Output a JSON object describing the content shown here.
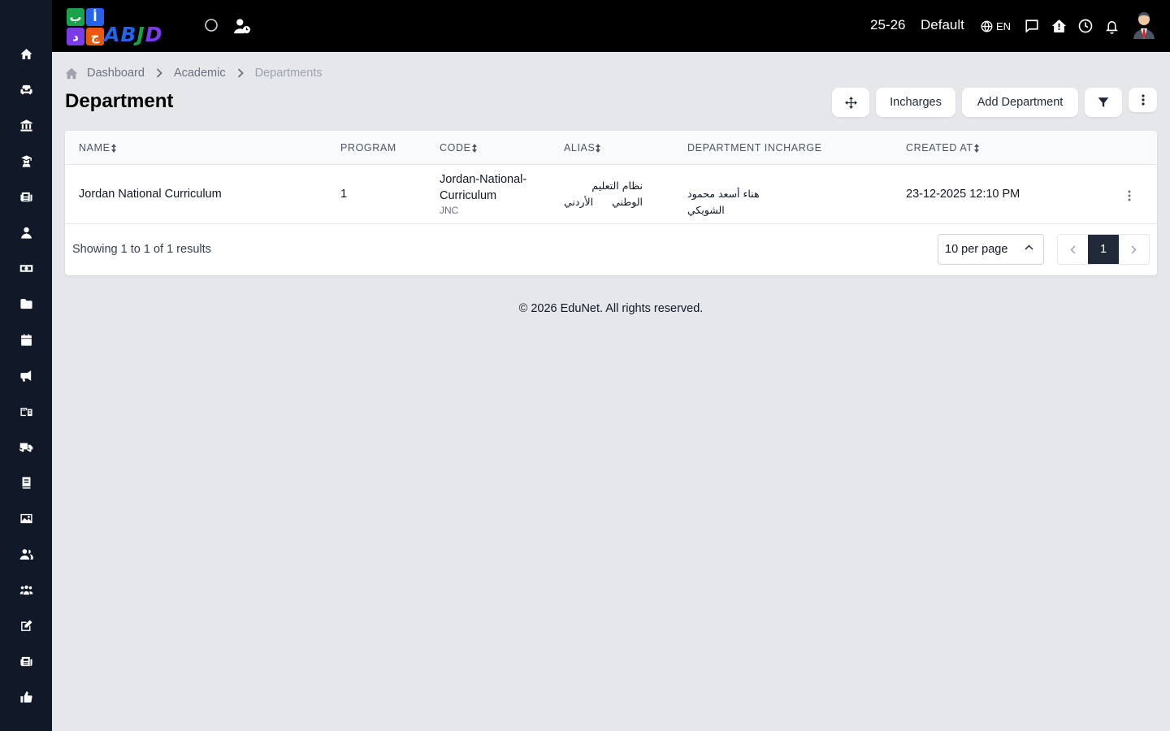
{
  "logo": {
    "tiles": [
      "ب",
      "أ",
      "د",
      "ج"
    ],
    "word": "ABJD",
    "colors": [
      "#16a34a",
      "#2563eb",
      "#7c3aed",
      "#ea580c"
    ]
  },
  "sidebar": {
    "items": [
      {
        "icon": "home-icon"
      },
      {
        "icon": "sofa-icon"
      },
      {
        "icon": "bank-icon"
      },
      {
        "icon": "graduate-icon"
      },
      {
        "icon": "newspaper-icon"
      },
      {
        "icon": "user-tie-icon"
      },
      {
        "icon": "money-icon"
      },
      {
        "icon": "folder-icon"
      },
      {
        "icon": "calendar-icon"
      },
      {
        "icon": "megaphone-icon"
      },
      {
        "icon": "school-icon"
      },
      {
        "icon": "truck-icon"
      },
      {
        "icon": "book-icon"
      },
      {
        "icon": "image-icon"
      },
      {
        "icon": "users-icon"
      },
      {
        "icon": "group-icon"
      },
      {
        "icon": "edit-icon"
      },
      {
        "icon": "news-icon"
      },
      {
        "icon": "thumbs-up-icon"
      }
    ]
  },
  "header": {
    "session": "25-26",
    "profile": "Default",
    "language": "EN",
    "icons": [
      "circle-icon",
      "user-clock-icon",
      "globe-icon",
      "chat-icon",
      "home-alert-icon",
      "clock-icon",
      "bell-icon",
      "avatar"
    ]
  },
  "breadcrumb": [
    "Dashboard",
    "Academic",
    "Departments"
  ],
  "page": {
    "title": "Department"
  },
  "toolbar": {
    "move_icon": "move-icon",
    "incharges": "Incharges",
    "add": "Add Department",
    "filter_icon": "filter-icon",
    "more_icon": "more-vertical-icon"
  },
  "table": {
    "columns": [
      "NAME",
      "PROGRAM",
      "CODE",
      "ALIAS",
      "DEPARTMENT INCHARGE",
      "CREATED AT"
    ],
    "rows": [
      {
        "name": "Jordan National Curriculum",
        "program": "1",
        "code_line1": "Jordan-National-",
        "code_line2": "Curriculum",
        "code_short": "JNC",
        "alias_line1": "نظام التعليم الوطني",
        "alias_line2": "الأردني",
        "incharge": "هناء أسعد محمود الشويكي",
        "created_at": "23-12-2025 12:10 PM"
      }
    ]
  },
  "pagination": {
    "showing": "Showing 1 to 1 of 1 results",
    "per_page": "10 per page",
    "current": "1"
  },
  "footer": {
    "text": "© 2026 EduNet. All rights reserved."
  },
  "colors": {
    "sidebar": "#111827",
    "header": "#000000",
    "background": "#e5e7eb",
    "active_page": "#1f2937"
  }
}
